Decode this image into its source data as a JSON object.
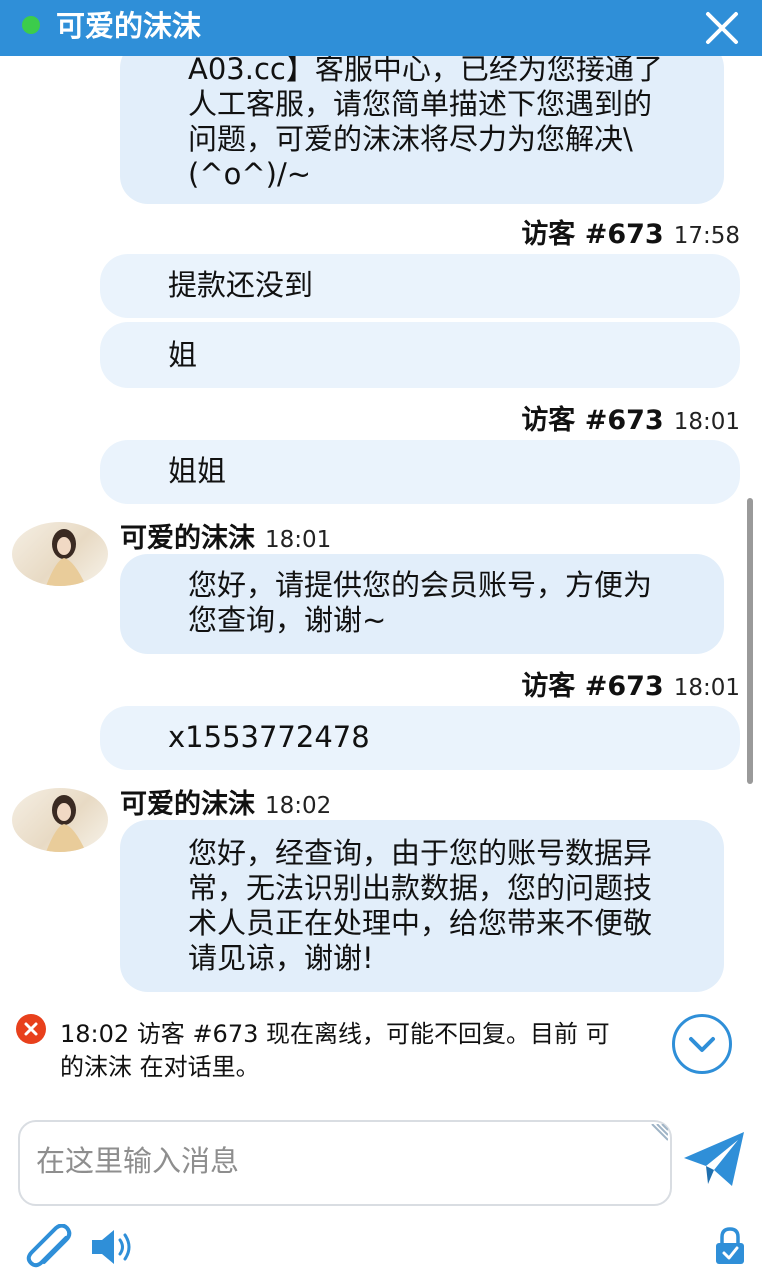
{
  "header": {
    "title": "可爱的沫沫",
    "status_color": "#3ccc4b",
    "brand_color": "#2f8fd8"
  },
  "messages": [
    {
      "type": "agent",
      "lines": [
        "A03.cc】客服中心，已经为您接通了",
        "人工客服，请您简单描述下您遇到的",
        "问题，可爱的沫沫将尽力为您解决\\",
        "(^o^)/~"
      ]
    },
    {
      "type": "visitor",
      "sender": "访客 #673",
      "time": "17:58",
      "parts": [
        "提款还没到",
        "姐"
      ]
    },
    {
      "type": "visitor",
      "sender": "访客 #673",
      "time": "18:01",
      "parts": [
        "姐姐"
      ]
    },
    {
      "type": "agent",
      "sender": "可爱的沫沫",
      "time": "18:01",
      "lines": [
        "您好，请提供您的会员账号，方便为",
        "您查询，谢谢~"
      ]
    },
    {
      "type": "visitor",
      "sender": "访客 #673",
      "time": "18:01",
      "parts": [
        "x1553772478"
      ]
    },
    {
      "type": "agent",
      "sender": "可爱的沫沫",
      "time": "18:02",
      "lines": [
        "您好，经查询，由于您的账号数据异",
        "常，无法识别出款数据，您的问题技",
        "术人员正在处理中，给您带来不便敬",
        "请见谅，谢谢!"
      ]
    }
  ],
  "notice": {
    "time": "18:02",
    "line1": "访客 #673 现在离线，可能不回复。目前 可",
    "line2": "的沫沫 在对话里。"
  },
  "input": {
    "placeholder": "在这里输入消息",
    "value": ""
  },
  "icons": {
    "close": "close-icon",
    "send": "send-icon",
    "attach": "paperclip-icon",
    "sound": "speaker-icon",
    "lock": "lock-icon",
    "scroll_down": "chevron-down-icon"
  }
}
